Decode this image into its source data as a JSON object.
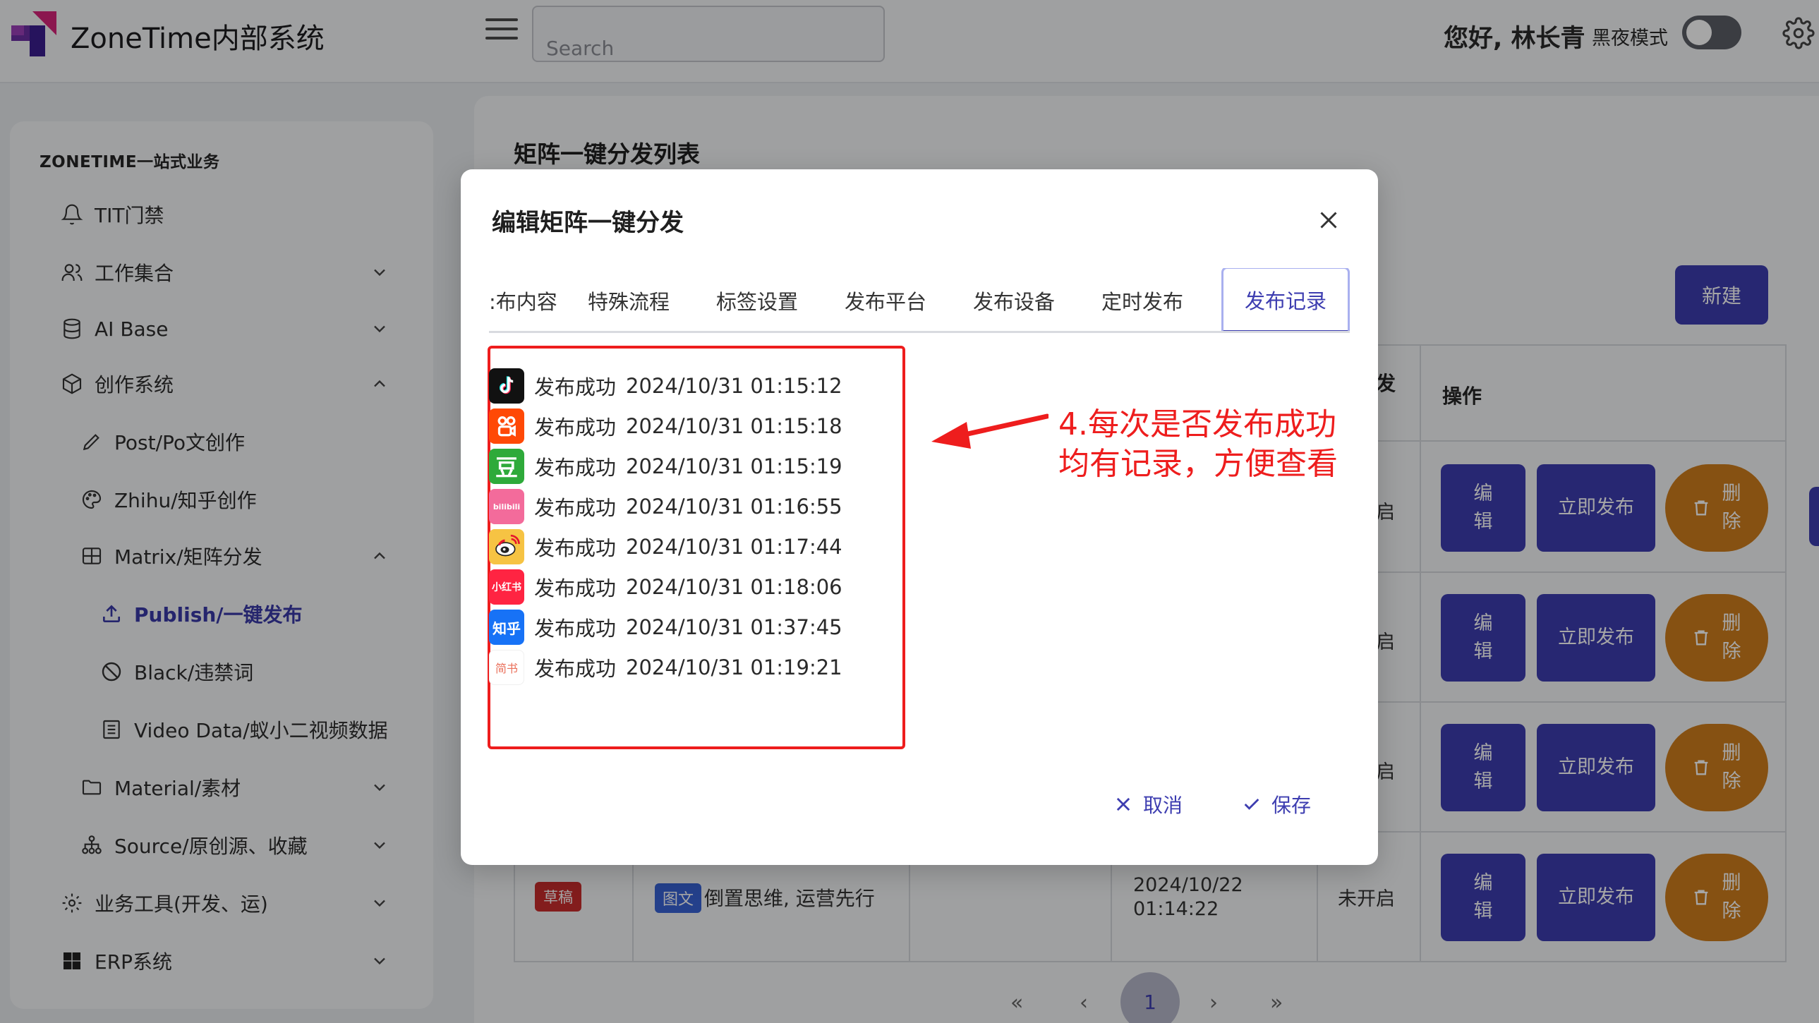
{
  "header": {
    "app_title": "ZoneTime内部系统",
    "search_placeholder": "Search",
    "greeting": "您好, 林长青",
    "dark_mode_label": "黑夜模式"
  },
  "sidebar": {
    "section_title": "ZONETIME一站式业务",
    "items": [
      {
        "label": "TIT门禁",
        "icon": "bell-icon"
      },
      {
        "label": "工作集合",
        "icon": "users-icon",
        "expanded": false
      },
      {
        "label": "AI Base",
        "icon": "database-icon",
        "expanded": false
      },
      {
        "label": "创作系统",
        "icon": "cube-icon",
        "expanded": true
      },
      {
        "label": "Post/Po文创作",
        "icon": "pencil-icon"
      },
      {
        "label": "Zhihu/知乎创作",
        "icon": "palette-icon"
      },
      {
        "label": "Matrix/矩阵分发",
        "icon": "grid-icon",
        "expanded": true
      },
      {
        "label": "Publish/一键发布",
        "icon": "upload-icon",
        "active": true
      },
      {
        "label": "Black/违禁词",
        "icon": "ban-icon"
      },
      {
        "label": "Video Data/蚁小二视频数据",
        "icon": "document-icon"
      },
      {
        "label": "Material/素材",
        "icon": "folder-icon",
        "expanded": false
      },
      {
        "label": "Source/原创源、收藏",
        "icon": "sitemap-icon",
        "expanded": false
      },
      {
        "label": "业务工具(开发、运)",
        "icon": "gear-icon",
        "expanded": false
      },
      {
        "label": "ERP系统",
        "icon": "windows-icon",
        "expanded": false
      }
    ]
  },
  "main": {
    "title": "矩阵一键分发列表",
    "new_button": "新建",
    "col_header_ops": "操作",
    "col_header_partial": "发",
    "row_status_partial": [
      "启",
      "启",
      "启"
    ],
    "row4": {
      "badge": "草稿",
      "type_badge": "图文",
      "title": "倒置思维, 运营先行",
      "date": "2024/10/22 01:14:22",
      "status": "未开启"
    },
    "ops": {
      "edit": "编辑",
      "publish": "立即发布",
      "delete": "删除"
    },
    "pagination": {
      "first": "«",
      "prev": "‹",
      "current": "1",
      "next": "›",
      "last": "»"
    }
  },
  "modal": {
    "title": "编辑矩阵一键分发",
    "tabs": [
      ":布内容",
      "特殊流程",
      "标签设置",
      "发布平台",
      "发布设备",
      "定时发布",
      "发布记录"
    ],
    "active_tab": "发布记录",
    "records": [
      {
        "platform": "douyin",
        "icon_text": "",
        "icon_color": "#111111",
        "status": "发布成功",
        "time": "2024/10/31 01:15:12"
      },
      {
        "platform": "kuaishou",
        "icon_text": "",
        "icon_color": "#ff4906",
        "status": "发布成功",
        "time": "2024/10/31 01:15:18"
      },
      {
        "platform": "douban",
        "icon_text": "豆",
        "icon_color": "#2eaa3a",
        "status": "发布成功",
        "time": "2024/10/31 01:15:19"
      },
      {
        "platform": "bilibili",
        "icon_text": "bilibili",
        "icon_color": "#f36b9b",
        "status": "发布成功",
        "time": "2024/10/31 01:16:55"
      },
      {
        "platform": "weibo",
        "icon_text": "",
        "icon_color": "#f6c343",
        "status": "发布成功",
        "time": "2024/10/31 01:17:44"
      },
      {
        "platform": "xiaohongshu",
        "icon_text": "小红书",
        "icon_color": "#ff2442",
        "status": "发布成功",
        "time": "2024/10/31 01:18:06"
      },
      {
        "platform": "zhihu",
        "icon_text": "知乎",
        "icon_color": "#1772f6",
        "status": "发布成功",
        "time": "2024/10/31 01:37:45"
      },
      {
        "platform": "jianshu",
        "icon_text": "简书",
        "icon_color": "#ffffff",
        "status": "发布成功",
        "time": "2024/10/31 01:19:21"
      }
    ],
    "annotation": [
      "4.每次是否发布成功",
      "均有记录，方便查看"
    ],
    "cancel": "取消",
    "save": "保存"
  },
  "colors": {
    "primary": "#3d3db0",
    "danger": "#ee1d1d",
    "delete_button": "#ce7d1c"
  }
}
